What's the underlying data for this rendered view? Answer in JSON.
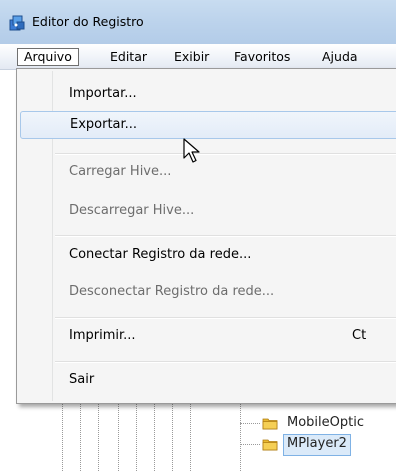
{
  "window": {
    "title": "Editor do Registro",
    "icon": "registry-editor-icon"
  },
  "menubar": {
    "items": [
      {
        "label": "Arquivo"
      },
      {
        "label": "Editar"
      },
      {
        "label": "Exibir"
      },
      {
        "label": "Favoritos"
      },
      {
        "label": "Ajuda"
      }
    ],
    "active": "Arquivo"
  },
  "file_menu": {
    "items": [
      {
        "label": "Importar...",
        "enabled": true
      },
      {
        "label": "Exportar...",
        "enabled": true,
        "highlighted": true
      },
      {
        "label": "Carregar Hive...",
        "enabled": false
      },
      {
        "label": "Descarregar Hive...",
        "enabled": false
      },
      {
        "label": "Conectar Registro da rede...",
        "enabled": true
      },
      {
        "label": "Desconectar Registro da rede...",
        "enabled": false
      },
      {
        "label": "Imprimir...",
        "enabled": true,
        "shortcut": "Ct"
      },
      {
        "label": "Sair",
        "enabled": true
      }
    ]
  },
  "tree": {
    "items": [
      {
        "label": "MobileOptic",
        "icon": "folder-icon"
      },
      {
        "label": "MPlayer2",
        "icon": "folder-icon",
        "selected": true
      }
    ]
  },
  "colors": {
    "titlebar": "#bcd3ec",
    "menu_background": "#f5f5f5",
    "highlight_border": "#a8c8ea",
    "disabled_text": "#6d6d6d",
    "selection_background": "#dbeaf9"
  }
}
